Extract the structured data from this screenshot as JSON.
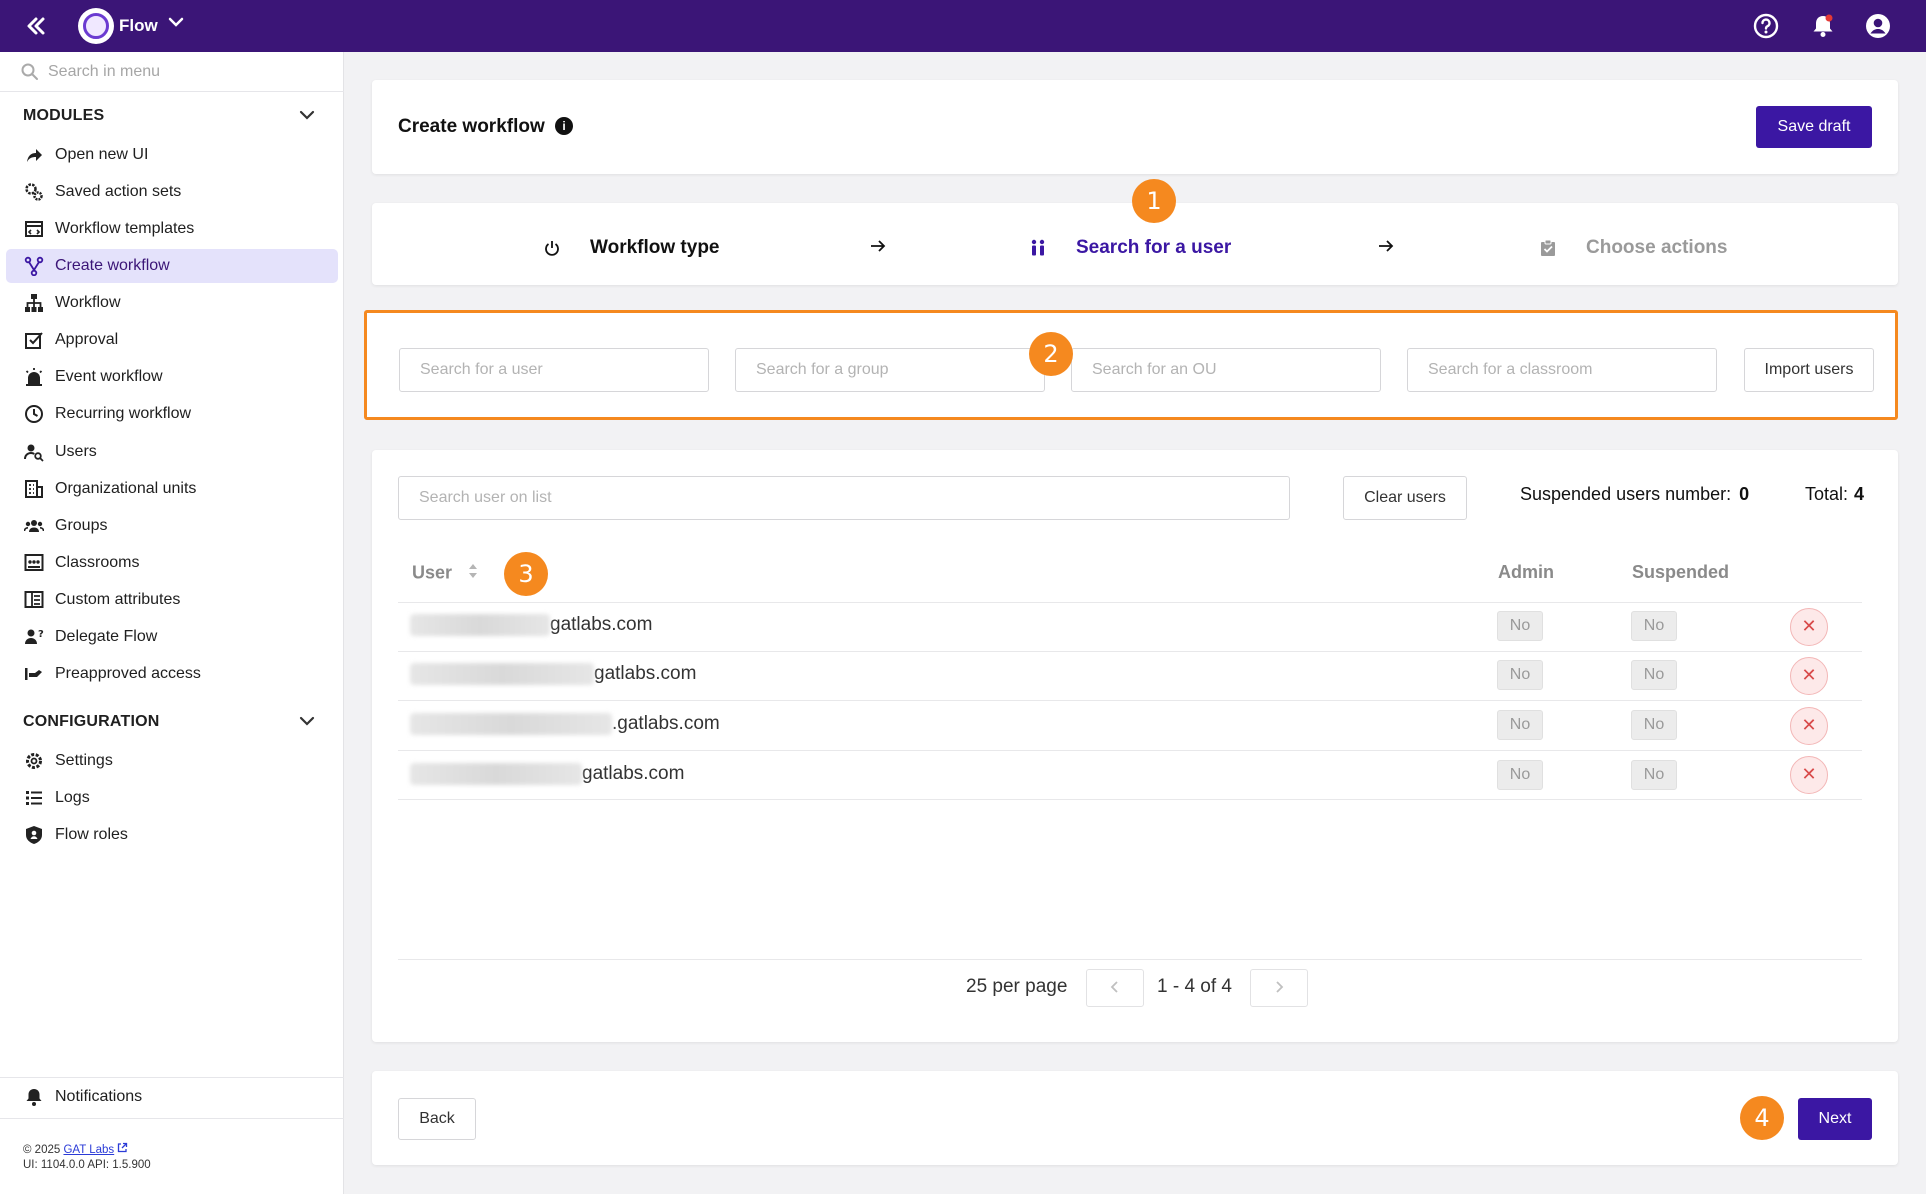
{
  "topbar": {
    "app_name": "Flow",
    "icons": [
      "double-chevron-left-icon",
      "flow-logo-icon",
      "chevron-down-icon",
      "help-icon",
      "bell-icon",
      "account-icon"
    ]
  },
  "sidebar": {
    "search_placeholder": "Search in menu",
    "modules_title": "MODULES",
    "modules": [
      {
        "label": "Open new UI",
        "icon": "share-arrow-icon"
      },
      {
        "label": "Saved action sets",
        "icon": "gears-icon"
      },
      {
        "label": "Workflow templates",
        "icon": "template-icon"
      },
      {
        "label": "Create workflow",
        "icon": "workflow-branch-icon",
        "active": true
      },
      {
        "label": "Workflow",
        "icon": "sitemap-icon"
      },
      {
        "label": "Approval",
        "icon": "checklist-icon"
      },
      {
        "label": "Event workflow",
        "icon": "alarm-light-icon"
      },
      {
        "label": "Recurring workflow",
        "icon": "clock-icon"
      },
      {
        "label": "Users",
        "icon": "user-search-icon"
      },
      {
        "label": "Organizational units",
        "icon": "building-icon"
      },
      {
        "label": "Groups",
        "icon": "groups-icon"
      },
      {
        "label": "Classrooms",
        "icon": "classroom-icon"
      },
      {
        "label": "Custom attributes",
        "icon": "columns-icon"
      },
      {
        "label": "Delegate Flow",
        "icon": "user-question-icon"
      },
      {
        "label": "Preapproved access",
        "icon": "preapproved-icon"
      }
    ],
    "config_title": "CONFIGURATION",
    "config": [
      {
        "label": "Settings",
        "icon": "gear-icon"
      },
      {
        "label": "Logs",
        "icon": "list-icon"
      },
      {
        "label": "Flow roles",
        "icon": "shield-user-icon"
      }
    ],
    "notifications_label": "Notifications",
    "copyright_prefix": "© 2025",
    "copyright_link": "GAT Labs",
    "version": "UI: 1104.0.0 API: 1.5.900"
  },
  "header": {
    "title": "Create workflow",
    "save_draft": "Save draft"
  },
  "steps": [
    {
      "label": "Workflow type",
      "icon": "power-icon",
      "state": "done"
    },
    {
      "label": "Search for a user",
      "icon": "people-icon",
      "state": "current"
    },
    {
      "label": "Choose actions",
      "icon": "clipboard-icon",
      "state": "pending"
    }
  ],
  "badges": [
    "1",
    "2",
    "3",
    "4"
  ],
  "search": {
    "user_placeholder": "Search for a user",
    "group_placeholder": "Search for a group",
    "ou_placeholder": "Search for an OU",
    "classroom_placeholder": "Search for a classroom",
    "import_users": "Import users"
  },
  "list": {
    "search_placeholder": "Search user on list",
    "clear_users": "Clear users",
    "suspended_label": "Suspended users number:",
    "suspended_count": "0",
    "total_label": "Total:",
    "total_count": "4",
    "columns": {
      "user": "User",
      "admin": "Admin",
      "suspended": "Suspended"
    },
    "rows": [
      {
        "email_suffix": "gatlabs.com",
        "admin": "No",
        "suspended": "No"
      },
      {
        "email_suffix": "gatlabs.com",
        "admin": "No",
        "suspended": "No"
      },
      {
        "email_suffix": ".gatlabs.com",
        "admin": "No",
        "suspended": "No"
      },
      {
        "email_suffix": "gatlabs.com",
        "admin": "No",
        "suspended": "No"
      }
    ],
    "per_page": "25 per page",
    "range": "1 - 4 of 4"
  },
  "footer": {
    "back": "Back",
    "next": "Next"
  },
  "colors": {
    "topbar": "#3b1577",
    "primary": "#3b17a3",
    "accent_orange": "#f5891f",
    "active_menu_bg": "#e4e2fb",
    "delete_red": "#d84a4a"
  }
}
